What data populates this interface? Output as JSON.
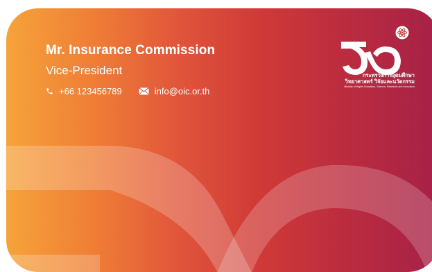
{
  "card": {
    "name": "Mr. Insurance Commission",
    "position": "Vice-President",
    "phone": "+66 123456789",
    "email": "info@oic.or.th"
  },
  "logo": {
    "line1": "กระทรวงการอุดมศึกษา",
    "line2": "วิทยาศาสตร์ วิจัยและนวัตกรรม",
    "line3": "Ministry of Higher Education, Science, Research and Innovation"
  },
  "icons": {
    "phone": "phone-icon",
    "email": "mail-icon",
    "logo": "ministry-logo-icon",
    "atom": "atom-icon"
  },
  "colors": {
    "gradient_left": "#f6a33a",
    "gradient_mid": "#d03a37",
    "gradient_right": "#a62148",
    "text": "#ffffff"
  }
}
